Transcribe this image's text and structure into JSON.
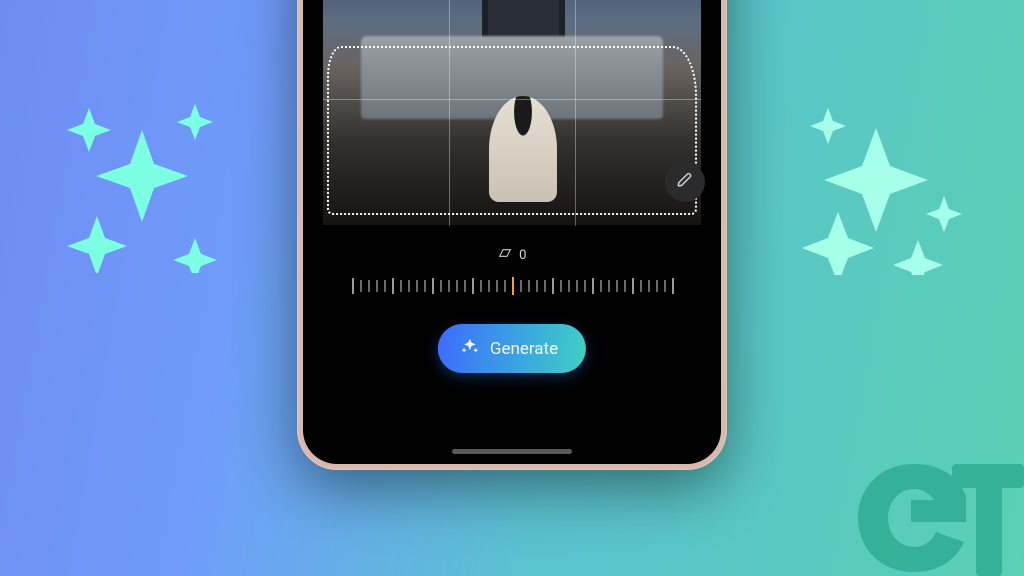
{
  "background": {
    "gradient_from": "#6f8cf2",
    "gradient_to": "#5ad0b3",
    "sparkle_color_left": "#7dffe4",
    "sparkle_color_right": "#a6ffe9"
  },
  "device": {
    "frame_color": "#d9b9ae"
  },
  "editor": {
    "angle": {
      "value": "0",
      "icon": "perspective-icon"
    },
    "ruler": {
      "tick_count": 41,
      "center_index": 20
    },
    "selection_active": true,
    "edit_badge_icon": "pencil-icon"
  },
  "generate_button": {
    "label": "Generate",
    "icon": "sparkle-icon"
  },
  "watermark": {
    "text": "GT"
  }
}
